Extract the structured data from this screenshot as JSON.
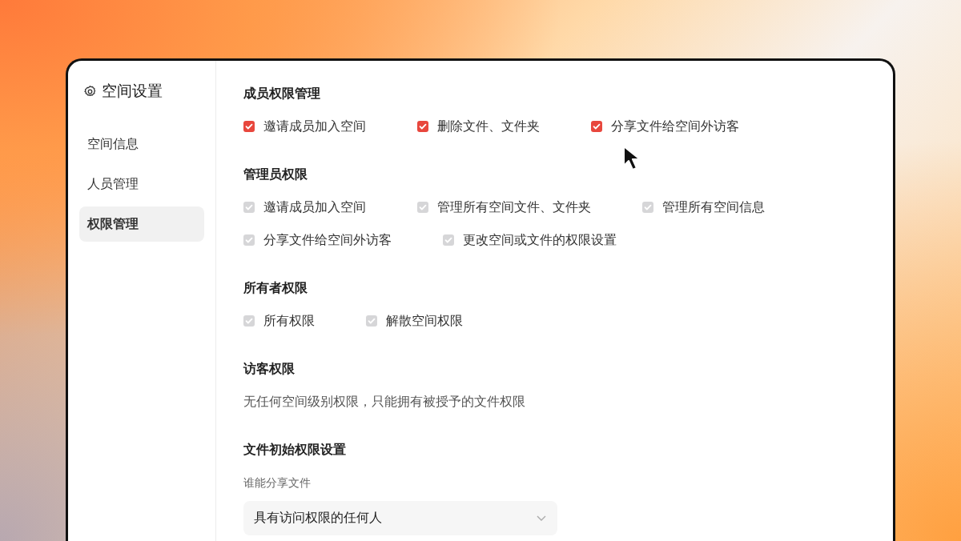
{
  "sidebar": {
    "title": "空间设置",
    "items": [
      {
        "label": "空间信息",
        "selected": false
      },
      {
        "label": "人员管理",
        "selected": false
      },
      {
        "label": "权限管理",
        "selected": true
      }
    ]
  },
  "sections": [
    {
      "kind": "checkboxes",
      "title": "成员权限管理",
      "options": [
        {
          "label": "邀请成员加入空间",
          "checked": true,
          "disabled": false
        },
        {
          "label": "删除文件、文件夹",
          "checked": true,
          "disabled": false
        },
        {
          "label": "分享文件给空间外访客",
          "checked": true,
          "disabled": false
        }
      ]
    },
    {
      "kind": "checkboxes",
      "title": "管理员权限",
      "options": [
        {
          "label": "邀请成员加入空间",
          "checked": true,
          "disabled": true
        },
        {
          "label": "管理所有空间文件、文件夹",
          "checked": true,
          "disabled": true
        },
        {
          "label": "管理所有空间信息",
          "checked": true,
          "disabled": true
        },
        {
          "label": "分享文件给空间外访客",
          "checked": true,
          "disabled": true
        },
        {
          "label": "更改空间或文件的权限设置",
          "checked": true,
          "disabled": true
        }
      ]
    },
    {
      "kind": "checkboxes",
      "title": "所有者权限",
      "options": [
        {
          "label": "所有权限",
          "checked": true,
          "disabled": true
        },
        {
          "label": "解散空间权限",
          "checked": true,
          "disabled": true
        }
      ]
    },
    {
      "kind": "text",
      "title": "访客权限",
      "text": "无任何空间级别权限，只能拥有被授予的文件权限"
    },
    {
      "kind": "select",
      "title": "文件初始权限设置",
      "field_label": "谁能分享文件",
      "value": "具有访问权限的任何人"
    }
  ]
}
